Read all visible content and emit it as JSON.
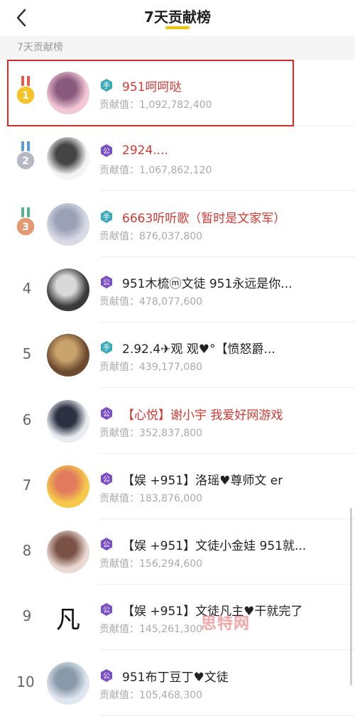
{
  "header": {
    "title": "7天贡献榜"
  },
  "section_label": "7天贡献榜",
  "value_prefix": "贡献值：",
  "rows": [
    {
      "rank": "1",
      "name": "951呵呵哒",
      "value": "1,092,782,400",
      "name_color": "red",
      "badge": "teal",
      "medal": "gold"
    },
    {
      "rank": "2",
      "name": "2924....",
      "value": "1,067,862,120",
      "name_color": "red",
      "badge": "purple",
      "medal": "silver"
    },
    {
      "rank": "3",
      "name": "6663听听歌（暂时是文家军）",
      "value": "876,037,800",
      "name_color": "red",
      "badge": "teal",
      "medal": "bronze"
    },
    {
      "rank": "4",
      "name": "951木梳ⓜ文徒 951永远是你...",
      "value": "478,077,600",
      "name_color": "black",
      "badge": "purple"
    },
    {
      "rank": "5",
      "name": "2.92.4✈观  观♥°【愤怒爵...",
      "value": "439,177,080",
      "name_color": "black",
      "badge": "teal"
    },
    {
      "rank": "6",
      "name": "【心悦】谢小宇 我爱好网游戏",
      "value": "352,837,800",
      "name_color": "red",
      "badge": "purple"
    },
    {
      "rank": "7",
      "name": "【娱 +951】洛瑶♥尊师文 er",
      "value": "183,876,000",
      "name_color": "black",
      "badge": "purple"
    },
    {
      "rank": "8",
      "name": "【娱 +951】文徒小金娃 951就...",
      "value": "156,294,600",
      "name_color": "black",
      "badge": "purple"
    },
    {
      "rank": "9",
      "name": "【娱 +951】文徒凡主♥干就完了",
      "value": "145,261,300",
      "name_color": "black",
      "badge": "purple"
    },
    {
      "rank": "10",
      "name": "951布丁豆丁♥文徒",
      "value": "105,468,300",
      "name_color": "black",
      "badge": "purple"
    }
  ],
  "badge_glyphs": {
    "teal": "手",
    "purple": "公"
  },
  "watermark": "思特网",
  "colors": {
    "accent": "#f5c400",
    "red_name": "#d13a33",
    "highlight_border": "#d12b2b",
    "badge_teal": "#3aa9b8",
    "badge_purple": "#7b4fc4"
  }
}
